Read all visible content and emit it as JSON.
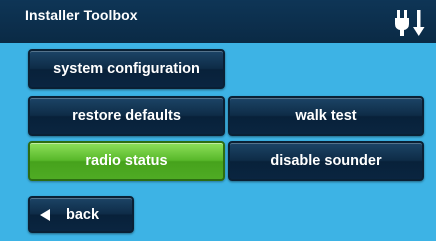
{
  "window": {
    "title": "Installer Toolbox",
    "status_icon": "plug-power-icon"
  },
  "menu": {
    "system_configuration": "system configuration",
    "restore_defaults": "restore defaults",
    "walk_test": "walk test",
    "radio_status": "radio status",
    "disable_sounder": "disable sounder"
  },
  "nav": {
    "back": "back"
  },
  "colors": {
    "background": "#3db3e5",
    "title_bar": "#0e3556",
    "button": "#0e2c47",
    "active_button": "#58b82a"
  }
}
